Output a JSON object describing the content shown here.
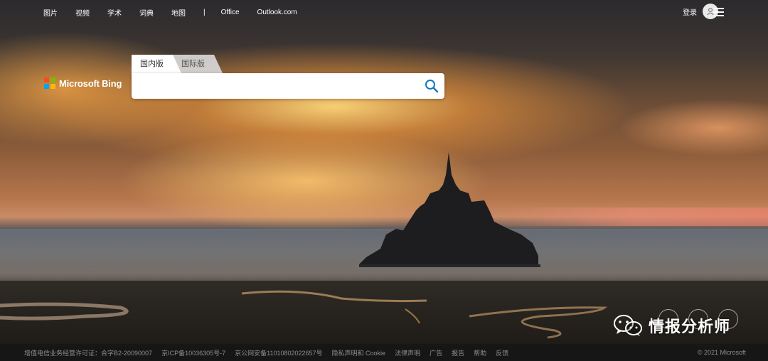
{
  "nav": {
    "links": [
      "图片",
      "视频",
      "学术",
      "词典",
      "地图"
    ],
    "separator": "|",
    "links2": [
      "Office",
      "Outlook.com"
    ]
  },
  "account": {
    "login_label": "登录",
    "avatar_icon": "user-icon",
    "menu_icon": "hamburger-menu-icon"
  },
  "logo": {
    "text": "Microsoft Bing",
    "colors": [
      "#f25022",
      "#7fba00",
      "#00a4ef",
      "#ffb900"
    ]
  },
  "search": {
    "tabs": [
      "国内版",
      "国际版"
    ],
    "active_tab": "国内版",
    "value": "",
    "placeholder": "",
    "search_icon": "search-icon",
    "accent": "#1177bb"
  },
  "watermark": {
    "text": "情报分析师",
    "icon": "wechat-icon"
  },
  "footer": {
    "items": [
      "增值电信业务经营许可证：合字B2-20090007",
      "京ICP备10036305号-7",
      "京公网安备11010802022657号",
      "隐私声明和 Cookie",
      "法律声明",
      "广告",
      "报告",
      "帮助",
      "反馈"
    ],
    "copyright": "© 2021 Microsoft"
  }
}
